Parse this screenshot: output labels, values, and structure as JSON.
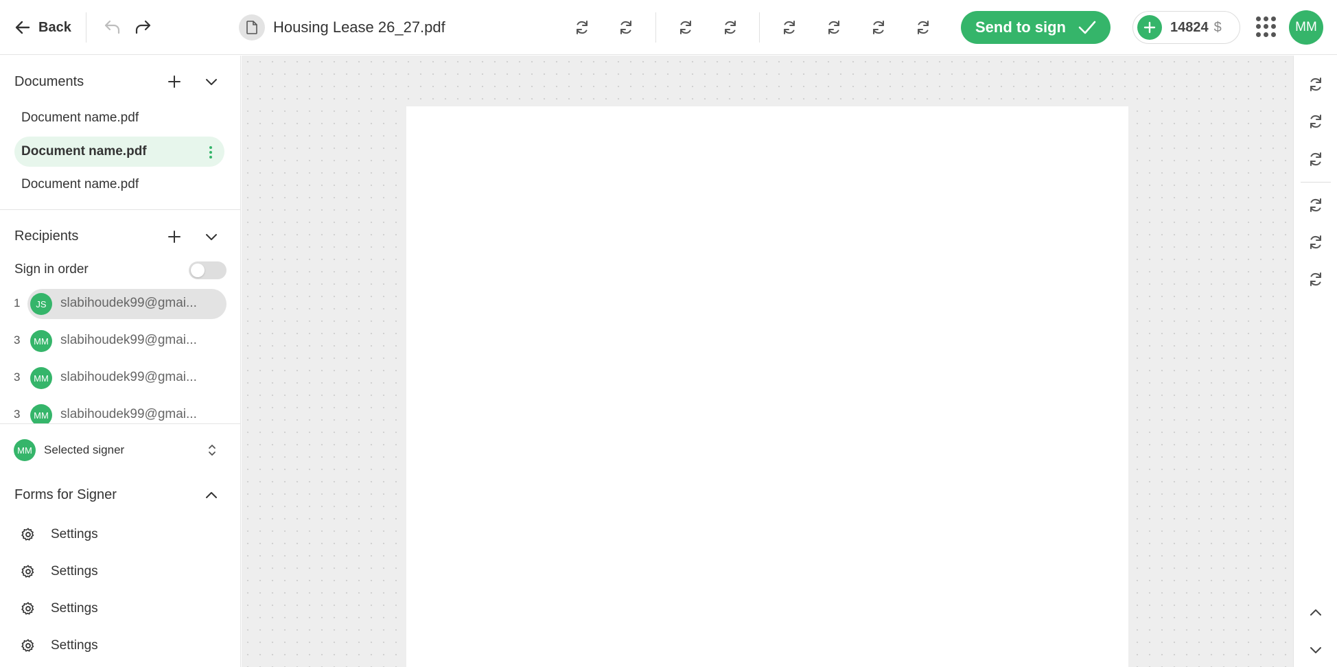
{
  "topbar": {
    "back_label": "Back",
    "document_title": "Housing Lease 26_27.pdf",
    "toolbar_icons": [
      "refresh-icon",
      "refresh-icon",
      "refresh-icon",
      "refresh-icon",
      "refresh-icon",
      "refresh-icon",
      "refresh-icon",
      "refresh-icon"
    ],
    "send_label": "Send to sign",
    "credits": {
      "amount": "14824",
      "currency": "$"
    },
    "user_initials": "MM"
  },
  "documents": {
    "title": "Documents",
    "items": [
      {
        "name": "Document name.pdf",
        "active": false
      },
      {
        "name": "Document name.pdf",
        "active": true
      },
      {
        "name": "Document name.pdf",
        "active": false
      }
    ]
  },
  "recipients": {
    "title": "Recipients",
    "sign_in_order_label": "Sign in order",
    "sign_in_order_enabled": false,
    "items": [
      {
        "order": "1",
        "initials": "JS",
        "email": "slabihoudek99@gmai...",
        "active": true
      },
      {
        "order": "3",
        "initials": "MM",
        "email": "slabihoudek99@gmai...",
        "active": false
      },
      {
        "order": "3",
        "initials": "MM",
        "email": "slabihoudek99@gmai...",
        "active": false
      },
      {
        "order": "3",
        "initials": "MM",
        "email": "slabihoudek99@gmai...",
        "active": false
      }
    ]
  },
  "signer": {
    "initials": "MM",
    "label": "Selected signer"
  },
  "forms": {
    "title": "Forms for Signer",
    "items": [
      {
        "label": "Settings",
        "icon": "gear-icon"
      },
      {
        "label": "Settings",
        "icon": "gear-icon"
      },
      {
        "label": "Settings",
        "icon": "gear-icon"
      },
      {
        "label": "Settings",
        "icon": "gear-icon"
      }
    ]
  },
  "right_rail": {
    "icons": [
      "refresh-icon",
      "refresh-icon",
      "refresh-icon",
      "refresh-icon",
      "refresh-icon",
      "refresh-icon"
    ],
    "nav": [
      "chevron-up-icon",
      "chevron-down-icon"
    ]
  },
  "colors": {
    "accent": "#35b56a",
    "active_doc_bg": "#e7f6ec",
    "canvas_bg": "#eeeeee"
  }
}
